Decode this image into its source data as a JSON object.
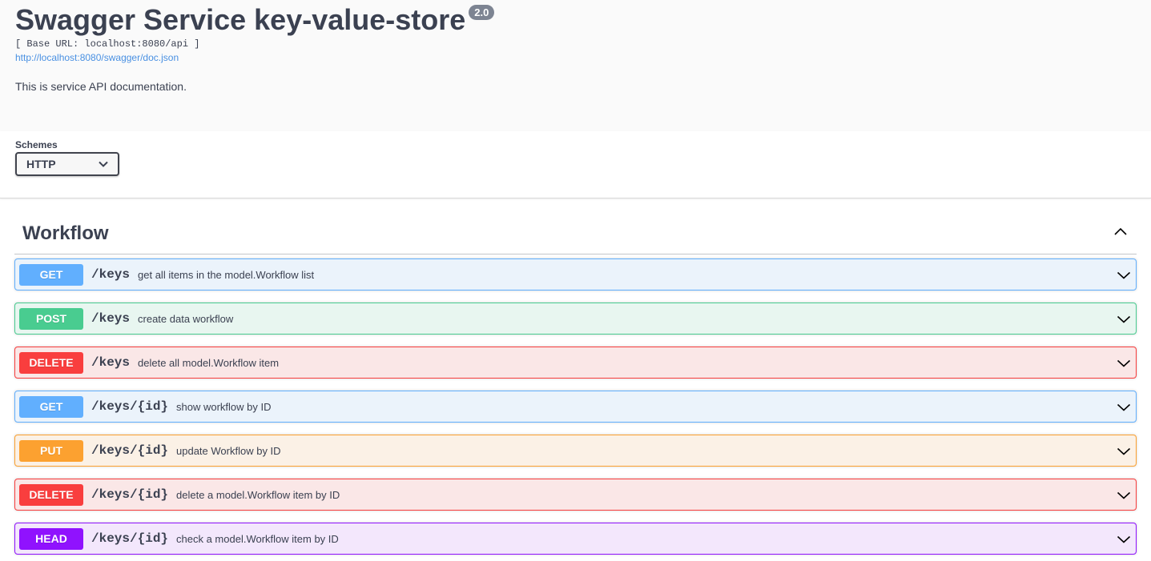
{
  "info": {
    "title": "Swagger Service key-value-store",
    "version": "2.0",
    "base_url": "[ Base URL: localhost:8080/api ]",
    "doc_link": "http://localhost:8080/swagger/doc.json",
    "description": "This is service API documentation."
  },
  "schemes": {
    "label": "Schemes",
    "selected": "HTTP"
  },
  "tag": {
    "name": "Workflow"
  },
  "colors": {
    "GET": "#61affe",
    "POST": "#49cc90",
    "DELETE": "#f93e3e",
    "PUT": "#fca130",
    "HEAD": "#9012fe"
  },
  "operations": [
    {
      "method": "GET",
      "path": "/keys",
      "summary": "get all items in the model.Workflow list"
    },
    {
      "method": "POST",
      "path": "/keys",
      "summary": "create data workflow"
    },
    {
      "method": "DELETE",
      "path": "/keys",
      "summary": "delete all model.Workflow item"
    },
    {
      "method": "GET",
      "path": "/keys/{id}",
      "summary": "show workflow by ID"
    },
    {
      "method": "PUT",
      "path": "/keys/{id}",
      "summary": "update Workflow by ID"
    },
    {
      "method": "DELETE",
      "path": "/keys/{id}",
      "summary": "delete a model.Workflow item by ID"
    },
    {
      "method": "HEAD",
      "path": "/keys/{id}",
      "summary": "check a model.Workflow item by ID"
    }
  ]
}
